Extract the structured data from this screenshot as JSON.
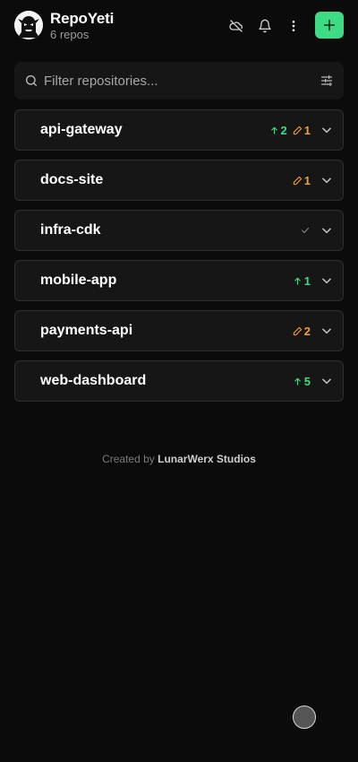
{
  "header": {
    "title": "RepoYeti",
    "subtitle": "6 repos",
    "avatar_icon": "yeti-logo-icon",
    "icons": [
      "cloud-off-icon",
      "bell-icon",
      "more-vertical-icon",
      "plus-icon"
    ]
  },
  "search": {
    "placeholder": "Filter repositories...",
    "value": "",
    "icon": "search-icon",
    "filter_icon": "sliders-icon"
  },
  "repos": [
    {
      "name": "api-gateway",
      "ahead": "2",
      "modified": "1",
      "synced": false
    },
    {
      "name": "docs-site",
      "ahead": null,
      "modified": "1",
      "synced": false
    },
    {
      "name": "infra-cdk",
      "ahead": null,
      "modified": null,
      "synced": true
    },
    {
      "name": "mobile-app",
      "ahead": "1",
      "modified": null,
      "synced": false
    },
    {
      "name": "payments-api",
      "ahead": null,
      "modified": "2",
      "synced": false
    },
    {
      "name": "web-dashboard",
      "ahead": "5",
      "modified": null,
      "synced": false
    }
  ],
  "footer": {
    "prefix": "Created by ",
    "studio": "LunarWerx Studios"
  },
  "colors": {
    "accent": "#3ddc84",
    "modified": "#f0a03c",
    "background": "#0b0b0b",
    "card": "#161616"
  }
}
